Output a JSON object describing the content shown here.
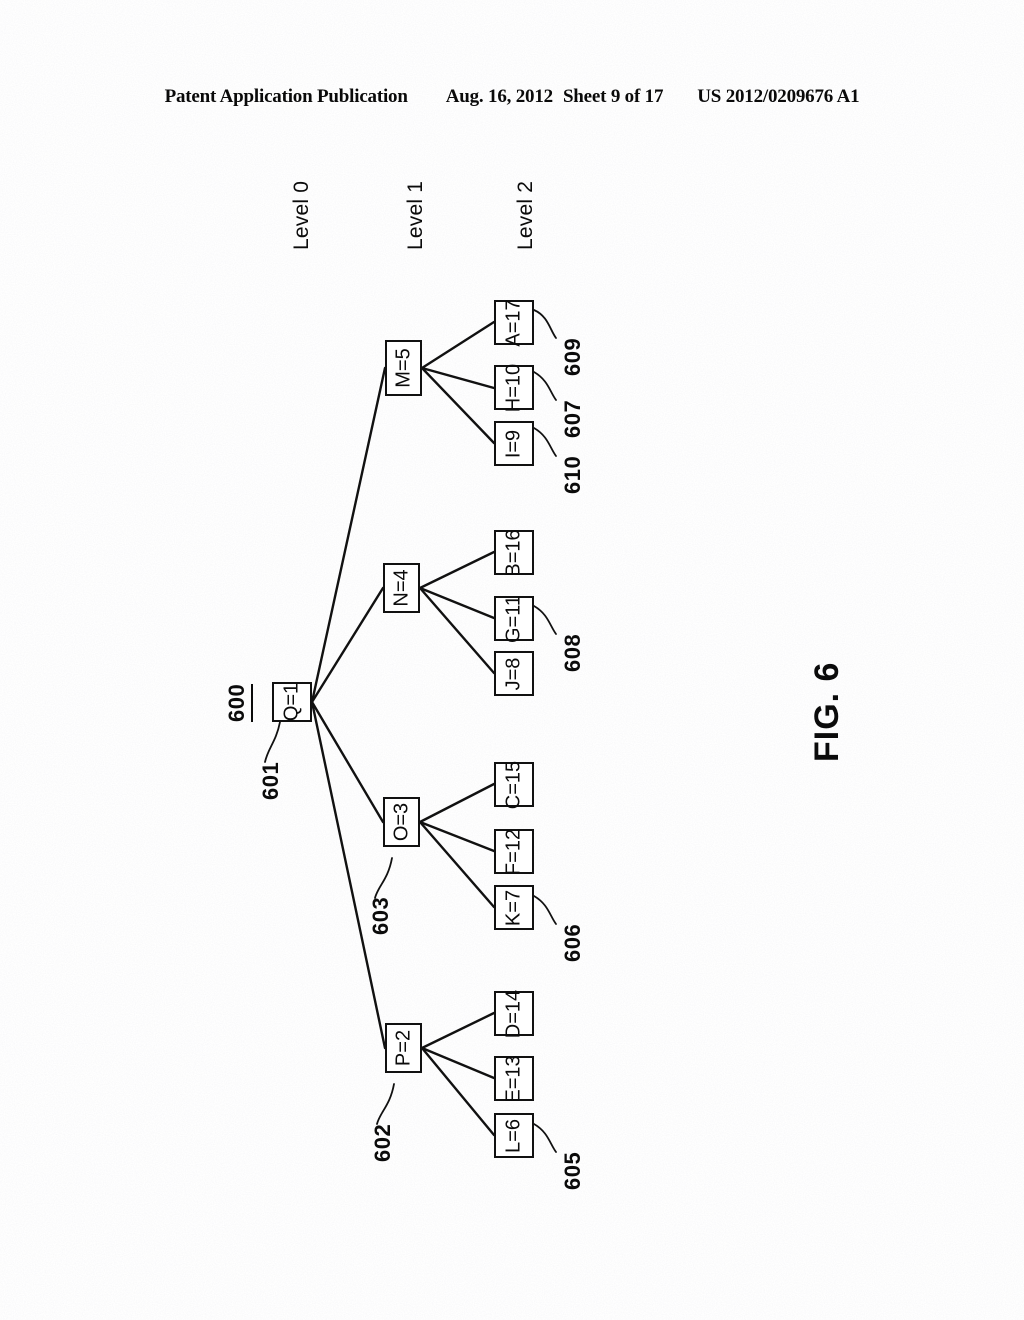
{
  "header": {
    "publication": "Patent Application Publication",
    "date": "Aug. 16, 2012",
    "sheet": "Sheet 9 of 17",
    "patent_number": "US 2012/0209676 A1"
  },
  "figure": {
    "caption": "FIG. 6",
    "figure_id": "600",
    "orientation": "landscape-rotated-90"
  },
  "level_labels": [
    {
      "text": "Level 0"
    },
    {
      "text": "Level 1"
    },
    {
      "text": "Level 2"
    }
  ],
  "tree": {
    "root": {
      "label": "Q=1",
      "ref": "601",
      "level": 0
    },
    "level1": [
      {
        "label": "M=5",
        "ref": "",
        "level": 1
      },
      {
        "label": "N=4",
        "ref": "",
        "level": 1
      },
      {
        "label": "O=3",
        "ref": "603",
        "level": 1
      },
      {
        "label": "P=2",
        "ref": "602",
        "level": 1
      }
    ],
    "level2": [
      {
        "label": "A=17",
        "ref": "609",
        "parent": "M=5"
      },
      {
        "label": "H=10",
        "ref": "607",
        "parent": "M=5"
      },
      {
        "label": "I=9",
        "ref": "610",
        "parent": "M=5"
      },
      {
        "label": "B=16",
        "ref": "",
        "parent": "N=4"
      },
      {
        "label": "G=11",
        "ref": "608",
        "parent": "N=4"
      },
      {
        "label": "J=8",
        "ref": "",
        "parent": "N=4"
      },
      {
        "label": "C=15",
        "ref": "",
        "parent": "O=3"
      },
      {
        "label": "F=12",
        "ref": "",
        "parent": "O=3"
      },
      {
        "label": "K=7",
        "ref": "606",
        "parent": "O=3"
      },
      {
        "label": "D=14",
        "ref": "",
        "parent": "P=2"
      },
      {
        "label": "E=13",
        "ref": "",
        "parent": "P=2"
      },
      {
        "label": "L=6",
        "ref": "605",
        "parent": "P=2"
      }
    ]
  },
  "colors": {
    "ink": "#111111",
    "page": "#ffffff"
  }
}
